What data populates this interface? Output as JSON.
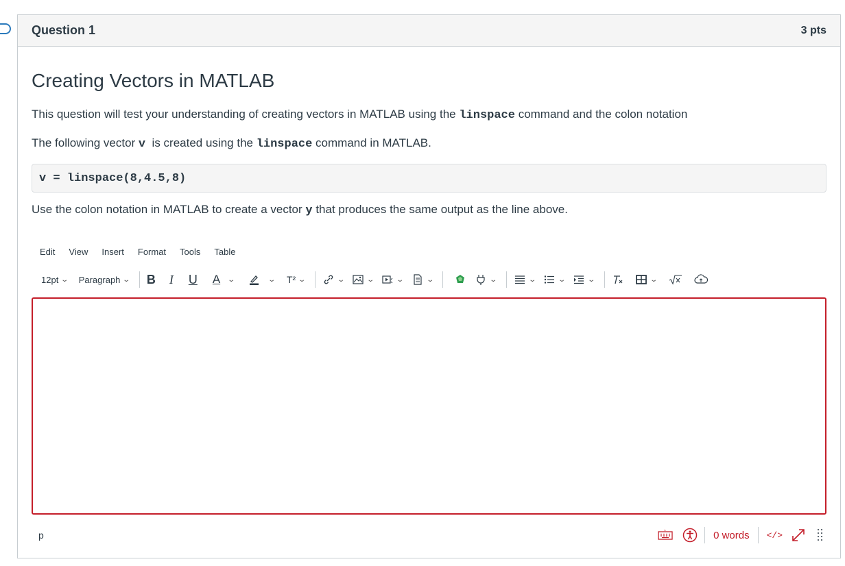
{
  "question": {
    "title": "Question 1",
    "points": "3 pts",
    "heading": "Creating Vectors in MATLAB",
    "intro_before": "This question will test your understanding of creating vectors in MATLAB using the ",
    "intro_code": "linspace",
    "intro_after": " command and the colon notation",
    "line2_before": "The following vector ",
    "line2_var": "v",
    "line2_mid": "  is created using the ",
    "line2_code": "linspace",
    "line2_after": " command in MATLAB.",
    "code": "v = linspace(8,4.5,8)",
    "line3_before": "Use the colon notation in MATLAB to create a vector ",
    "line3_var": "y",
    "line3_after": " that produces the same output as the line above."
  },
  "editor": {
    "menu": [
      "Edit",
      "View",
      "Insert",
      "Format",
      "Tools",
      "Table"
    ],
    "font_size": "12pt",
    "block_format": "Paragraph",
    "bold": "B",
    "italic": "I",
    "underline": "U",
    "text_color": "A",
    "superscript": "T²",
    "path": "p",
    "word_count": "0 words",
    "html_toggle": "</>",
    "accent_color": "#c41e2a"
  }
}
